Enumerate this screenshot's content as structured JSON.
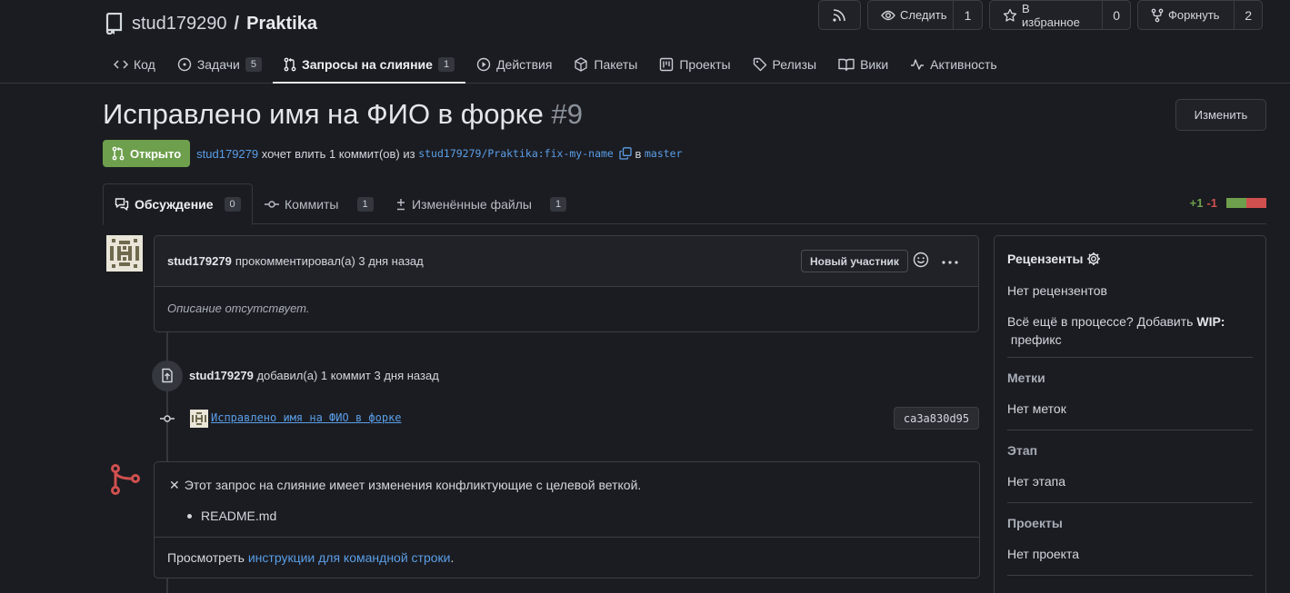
{
  "repo": {
    "owner": "stud179290",
    "separator": "/",
    "name": "Praktika"
  },
  "repo_actions": {
    "watch_label": "Следить",
    "watch_count": "1",
    "star_label": "В избранное",
    "star_count": "0",
    "fork_label": "Форкнуть",
    "fork_count": "2"
  },
  "repo_tabs": [
    {
      "label": "Код"
    },
    {
      "label": "Задачи",
      "count": "5"
    },
    {
      "label": "Запросы на слияние",
      "count": "1"
    },
    {
      "label": "Действия"
    },
    {
      "label": "Пакеты"
    },
    {
      "label": "Проекты"
    },
    {
      "label": "Релизы"
    },
    {
      "label": "Вики"
    },
    {
      "label": "Активность"
    }
  ],
  "pr": {
    "title": "Исправлено имя на ФИО в форке",
    "number": "#9",
    "edit_label": "Изменить",
    "status": "Открыто",
    "author": "stud179279",
    "summary_mid": " хочет влить 1 коммит(ов) из ",
    "head_branch": "stud179279/Praktika:fix-my-name",
    "into": " в ",
    "base_branch": "master"
  },
  "pr_tabs": [
    {
      "label": "Обсуждение",
      "count": "0"
    },
    {
      "label": "Коммиты",
      "count": "1"
    },
    {
      "label": "Изменённые файлы",
      "count": "1"
    }
  ],
  "diffstat": {
    "additions": "+1",
    "deletions": "-1",
    "add_color": "#6d9f4c",
    "del_color": "#d0504f"
  },
  "comment": {
    "author": "stud179279",
    "action": "прокомментировал(а) 3 дня назад",
    "role": "Новый участник",
    "body": "Описание отсутствует."
  },
  "commit_event": {
    "author": "stud179279",
    "action": " добавил(а) 1 коммит 3 дня назад",
    "message": "Исправлено имя на ФИО в форке",
    "sha": "ca3a830d95"
  },
  "merge": {
    "conflict_icon": "✕",
    "conflict_text": "Этот запрос на слияние имеет изменения конфликтующие с целевой веткой.",
    "files": [
      "README.md"
    ],
    "foot_prefix": "Просмотреть ",
    "foot_link": "инструкции для командной строки",
    "foot_suffix": "."
  },
  "sidebar": {
    "reviewers_title": "Рецензенты",
    "reviewers_value": "Нет рецензентов",
    "wip_prefix": "Всё ещё в процессе? Добавить ",
    "wip_bold": "WIP:",
    "wip_suffix": " префикс",
    "labels_title": "Метки",
    "labels_value": "Нет меток",
    "milestone_title": "Этап",
    "milestone_value": "Нет этапа",
    "projects_title": "Проекты",
    "projects_value": "Нет проекта"
  }
}
